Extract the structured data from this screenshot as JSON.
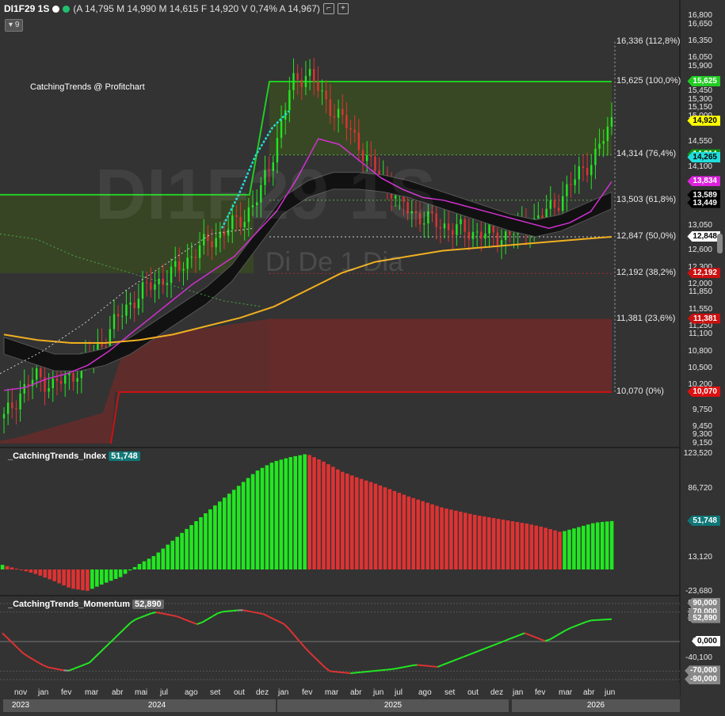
{
  "header": {
    "symbol": "DI1F29 1S",
    "ohlc_text": "(A 14,795 M 14,990 M 14,615 F 14,920 V 0,74% A 14,967)",
    "indicator_count": "9",
    "status_colors": [
      "#ffffff",
      "#20c070"
    ]
  },
  "watermark": {
    "symbol": "DI1F29 1S",
    "description": "Di De 1 Dia"
  },
  "study_title": "CatchingTrends @ Profitchart",
  "colors": {
    "up": "#22e622",
    "down": "#dd3333",
    "ema_fast": "#d030d0",
    "ema_slow": "#f0b020",
    "band": "#111111",
    "fib_top": "#22cc22",
    "fib_bottom": "#cc1111",
    "cyan": "#22dddd"
  },
  "fib_levels": [
    {
      "label": "16,336 (112,8%)",
      "price": 16.336
    },
    {
      "label": "15,625 (100,0%)",
      "price": 15.625
    },
    {
      "label": "14,314 (76,4%)",
      "price": 14.314
    },
    {
      "label": "13,503 (61,8%)",
      "price": 13.503
    },
    {
      "label": "12,847 (50,0%)",
      "price": 12.847
    },
    {
      "label": "12,192 (38,2%)",
      "price": 12.192
    },
    {
      "label": "11,381 (23,6%)",
      "price": 11.381
    },
    {
      "label": "10,070 (0%)",
      "price": 10.07
    }
  ],
  "price_axis_ticks": [
    "16,800",
    "16,650",
    "16,350",
    "16,050",
    "15,900",
    "15,450",
    "15,300",
    "15,150",
    "15,000",
    "14,550",
    "14,100",
    "13,050",
    "12,600",
    "12,300",
    "12,000",
    "11,850",
    "11,550",
    "11,250",
    "11,100",
    "10,800",
    "10,500",
    "10,200",
    "9,750",
    "9,450",
    "9,300",
    "9,150"
  ],
  "price_tags": [
    {
      "text": "15,625",
      "price": 15.625,
      "bg": "#22cc22",
      "fg": "#ffffff"
    },
    {
      "text": "14,920",
      "price": 14.92,
      "bg": "#ffff00",
      "fg": "#000000"
    },
    {
      "text": "14,314",
      "price": 14.314,
      "bg": "#119911",
      "fg": "#ffffff"
    },
    {
      "text": "14,265",
      "price": 14.265,
      "bg": "#22dddd",
      "fg": "#000000"
    },
    {
      "text": "13,834",
      "price": 13.834,
      "bg": "#dd22dd",
      "fg": "#ffffff"
    },
    {
      "text": "13,589",
      "price": 13.589,
      "bg": "#000000",
      "fg": "#ffffff"
    },
    {
      "text": "13,449",
      "price": 13.449,
      "bg": "#000000",
      "fg": "#ffffff"
    },
    {
      "text": "12,848",
      "price": 12.848,
      "bg": "#ffffff",
      "fg": "#000000"
    },
    {
      "text": "12,192",
      "price": 12.192,
      "bg": "#cc1111",
      "fg": "#ffffff"
    },
    {
      "text": "11,381",
      "price": 11.381,
      "bg": "#cc1111",
      "fg": "#ffffff"
    },
    {
      "text": "10,070",
      "price": 10.07,
      "bg": "#dd1111",
      "fg": "#ffffff"
    }
  ],
  "index_panel": {
    "name": "_CatchingTrends_Index",
    "value": "51,748",
    "value_bg": "#117777",
    "axis_ticks": [
      "123,520",
      "86,720",
      "13,120",
      "-23,680"
    ],
    "tag": {
      "text": "51,748",
      "bg": "#117777",
      "fg": "#ffffff"
    }
  },
  "momentum_panel": {
    "name": "_CatchingTrends_Momentum",
    "value": "52,890",
    "value_bg": "#666666",
    "axis_ticks": [
      "90,000",
      "70,000",
      "52,890",
      "55,440",
      "0,000",
      "-40,100",
      "-70,000",
      "-90,000"
    ],
    "tags": [
      {
        "text": "90,000",
        "bg": "#888888",
        "fg": "#ffffff"
      },
      {
        "text": "70,000",
        "bg": "#888888",
        "fg": "#ffffff"
      },
      {
        "text": "52,890",
        "bg": "#888888",
        "fg": "#ffffff"
      },
      {
        "text": "0,000",
        "bg": "#ffffff",
        "fg": "#000000"
      },
      {
        "text": "-70,000",
        "bg": "#888888",
        "fg": "#ffffff"
      },
      {
        "text": "-90,000",
        "bg": "#888888",
        "fg": "#ffffff"
      }
    ]
  },
  "time_axis": {
    "months": [
      "nov",
      "jan",
      "fev",
      "mar",
      "abr",
      "mai",
      "jul",
      "ago",
      "set",
      "out",
      "dez",
      "jan",
      "fev",
      "mar",
      "abr",
      "jun",
      "jul",
      "ago",
      "set",
      "out",
      "dez",
      "jan",
      "fev",
      "mar",
      "abr",
      "jun"
    ],
    "years": [
      "2023",
      "2024",
      "2025",
      "2026"
    ]
  },
  "chart_data": {
    "type": "candlestick",
    "title": "DI1F29 1S",
    "price_range": [
      9.15,
      16.8
    ],
    "last": {
      "open": 14.795,
      "high": 14.99,
      "low": 14.615,
      "close": 14.92,
      "change_pct": 0.74,
      "ask": 14.967
    },
    "close_series": [
      9.6,
      10.05,
      10.35,
      10.2,
      10.3,
      10.6,
      10.9,
      11.35,
      11.7,
      11.95,
      12.1,
      12.3,
      12.6,
      12.8,
      13.0,
      13.2,
      13.6,
      14.5,
      15.6,
      15.8,
      15.3,
      15.0,
      14.6,
      14.1,
      13.8,
      13.4,
      13.2,
      13.1,
      13.0,
      12.95,
      12.9,
      12.85,
      12.95,
      13.1,
      13.3,
      13.6,
      14.0,
      14.3,
      14.92
    ],
    "ema_fast": [
      10.1,
      10.15,
      10.3,
      10.4,
      10.55,
      10.8,
      11.1,
      11.4,
      11.7,
      12.0,
      12.25,
      12.5,
      12.9,
      13.3,
      13.9,
      14.6,
      14.5,
      14.2,
      13.9,
      13.7,
      13.55,
      13.5,
      13.4,
      13.3,
      13.2,
      13.1,
      13.0,
      13.1,
      13.3,
      13.834
    ],
    "ema_slow": [
      11.1,
      11.0,
      10.95,
      10.95,
      11.0,
      11.1,
      11.25,
      11.4,
      11.6,
      11.9,
      12.2,
      12.4,
      12.5,
      12.6,
      12.65,
      12.7,
      12.75,
      12.8,
      12.848
    ],
    "index_values": [
      5,
      0,
      -5,
      -12,
      -20,
      -23,
      -15,
      -8,
      5,
      15,
      30,
      45,
      60,
      75,
      90,
      105,
      115,
      120,
      123.52,
      115,
      105,
      98,
      92,
      85,
      78,
      72,
      66,
      62,
      58,
      55,
      52,
      49,
      45,
      40,
      45,
      50,
      51.748
    ],
    "momentum_values": [
      20,
      -30,
      -60,
      -70,
      -50,
      0,
      50,
      70,
      60,
      40,
      70,
      75,
      65,
      40,
      -20,
      -70,
      -75,
      -70,
      -65,
      -55,
      -60,
      -40,
      -20,
      0,
      20,
      0,
      30,
      50,
      52.89
    ]
  }
}
